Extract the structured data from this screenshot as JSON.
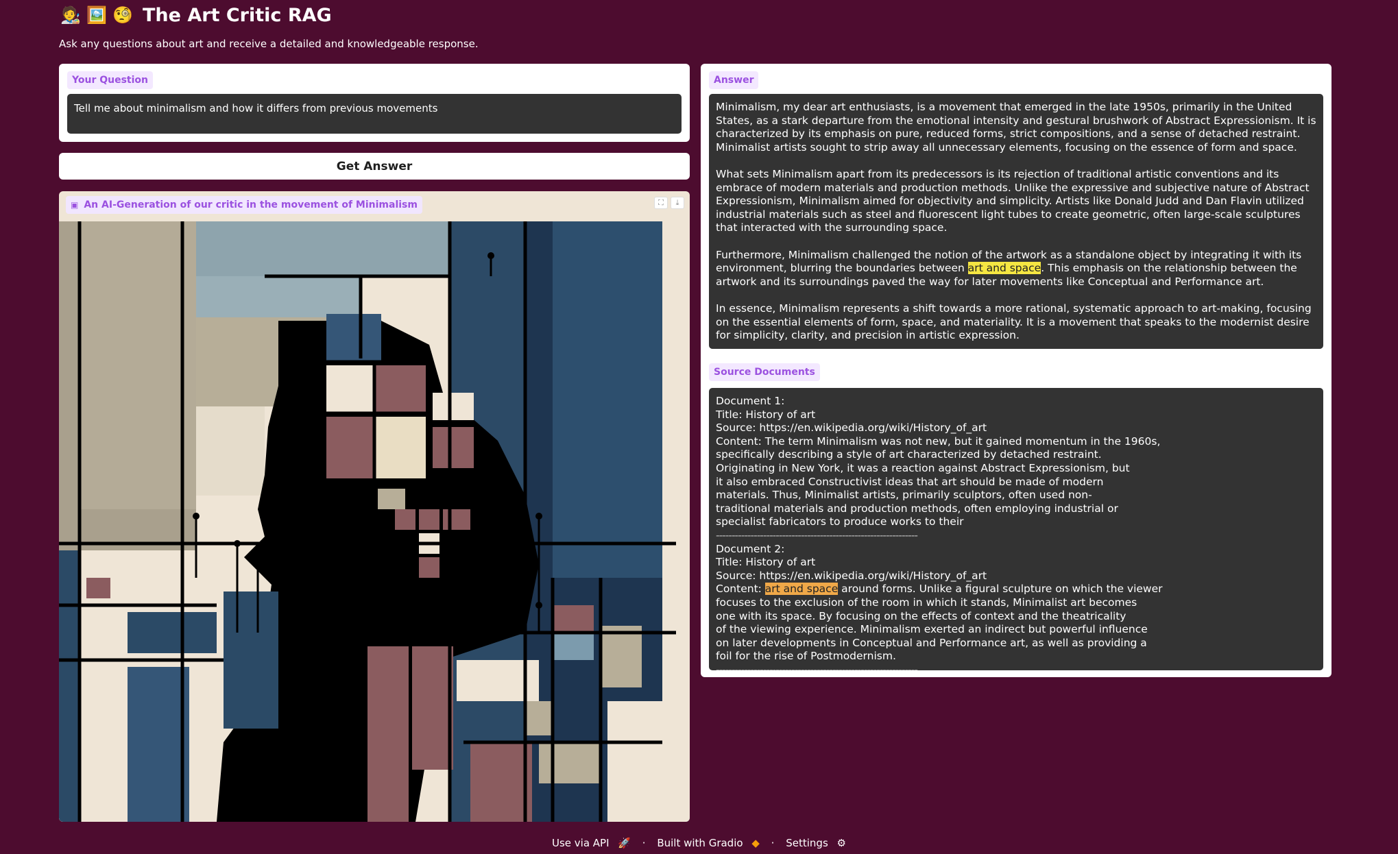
{
  "header": {
    "icons": [
      "person-artist-icon",
      "framed-picture-icon",
      "monocle-face-icon"
    ],
    "title": "The Art Critic RAG",
    "subtitle": "Ask any questions about art and receive a detailed and knowledgeable response."
  },
  "question": {
    "label": "Your Question",
    "value": "Tell me about minimalism and how it differs from previous movements"
  },
  "get_answer_button": "Get Answer",
  "image": {
    "label": "An AI-Generation of our critic in the movement of Minimalism",
    "tools": [
      "expand-icon",
      "download-icon"
    ]
  },
  "answer": {
    "label": "Answer",
    "p1": "Minimalism, my dear art enthusiasts, is a movement that emerged in the late 1950s, primarily in the United States, as a stark departure from the emotional intensity and gestural brushwork of Abstract Expressionism. It is characterized by its emphasis on pure, reduced forms, strict compositions, and a sense of detached restraint. Minimalist artists sought to strip away all unnecessary elements, focusing on the essence of form and space.",
    "p2": "What sets Minimalism apart from its predecessors is its rejection of traditional artistic conventions and its embrace of modern materials and production methods. Unlike the expressive and subjective nature of Abstract Expressionism, Minimalism aimed for objectivity and simplicity. Artists like Donald Judd and Dan Flavin utilized industrial materials such as steel and fluorescent light tubes to create geometric, often large-scale sculptures that interacted with the surrounding space.",
    "p3_before": "Furthermore, Minimalism challenged the notion of the artwork as a standalone object by integrating it with its environment, blurring the boundaries between ",
    "p3_highlight": "art and space",
    "p3_after": ". This emphasis on the relationship between the artwork and its surroundings paved the way for later movements like Conceptual and Performance art.",
    "p4": "In essence, Minimalism represents a shift towards a more rational, systematic approach to art-making, focusing on the essential elements of form, space, and materiality. It is a movement that speaks to the modernist desire for simplicity, clarity, and precision in artistic expression."
  },
  "sources": {
    "label": "Source Documents",
    "doc1": {
      "heading": "Document 1:",
      "title": "Title: History of art",
      "source": "Source: https://en.wikipedia.org/wiki/History_of_art",
      "content_lines": [
        "Content: The term Minimalism was not new, but it gained momentum in the 1960s,",
        "specifically describing a style of art characterized by detached restraint.",
        "Originating in New York, it was a reaction against Abstract Expressionism, but",
        "it also embraced Constructivist ideas that art should be made of modern",
        "materials. Thus, Minimalist artists, primarily sculptors, often used non-",
        "traditional materials and production methods, often employing industrial or",
        "specialist fabricators to produce works to their"
      ]
    },
    "separator": "----------------------------------------------------------------",
    "doc2": {
      "heading": "Document 2:",
      "title": "Title: History of art",
      "source": "Source: https://en.wikipedia.org/wiki/History_of_art",
      "content_prefix": "Content: ",
      "content_highlight": "art and space",
      "content_first_rest": " around forms. Unlike a figural sculpture on which the viewer",
      "content_lines": [
        "focuses to the exclusion of the room in which it stands, Minimalist art becomes",
        "one with its space. By focusing on the effects of context and the theatricality",
        "of the viewing experience. Minimalism exerted an indirect but powerful influence",
        "on later developments in Conceptual and Performance art, as well as providing a",
        "foil for the rise of Postmodernism."
      ]
    }
  },
  "footer": {
    "api": "Use via API",
    "api_icon": "rocket-icon",
    "dot1": "·",
    "built": "Built with Gradio",
    "built_icon": "gradio-logo-icon",
    "dot2": "·",
    "settings": "Settings",
    "settings_icon": "gear-icon"
  }
}
